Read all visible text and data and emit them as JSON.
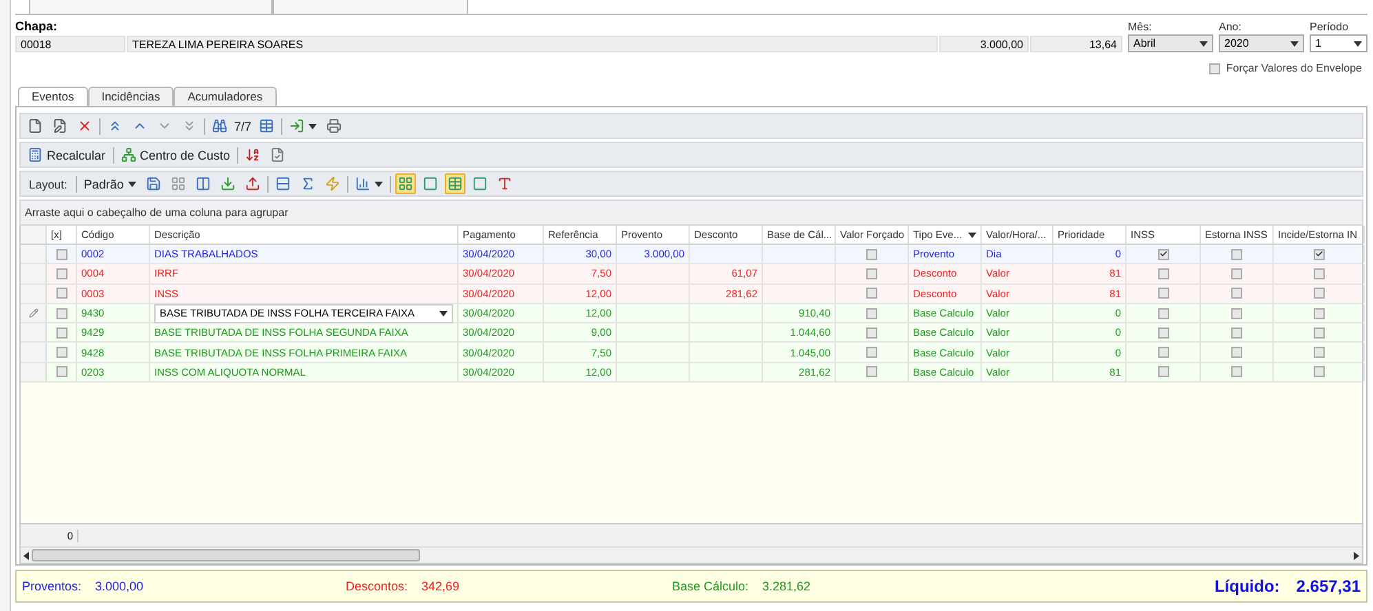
{
  "form": {
    "label": "Chapa:",
    "code": "00018",
    "name": "TEREZA LIMA PEREIRA SOARES",
    "value_1": "3.000,00",
    "value_2": "13,64"
  },
  "period": [
    {
      "label": "Mês:",
      "value": "Abril"
    },
    {
      "label": "Ano:",
      "value": "2020"
    },
    {
      "label": "Período",
      "value": "1"
    }
  ],
  "force_values": {
    "label": "Forçar Valores do Envelope",
    "checked": false
  },
  "tabs": [
    {
      "label": "Eventos",
      "selected": true
    },
    {
      "label": "Incidências",
      "selected": false
    },
    {
      "label": "Acumuladores",
      "selected": false
    }
  ],
  "toolbar": {
    "record_counter": "7/7"
  },
  "actions": [
    {
      "kind": "calc",
      "label": "Recalcular"
    },
    {
      "kind": "cost",
      "label": "Centro de Custo"
    }
  ],
  "layout_bar": {
    "label": "Layout:",
    "preset": "Padrão",
    "toggles": [
      {
        "selected": true
      },
      {
        "selected": false
      },
      {
        "selected": true
      },
      {
        "selected": false
      },
      {
        "selected": false
      }
    ]
  },
  "group_hint": "Arraste aqui o cabeçalho de uma coluna para agrupar",
  "table": {
    "columns": [
      {
        "label": "[x]",
        "kind": "check"
      },
      {
        "label": "Código",
        "kind": "text"
      },
      {
        "label": "Descrição",
        "kind": "text"
      },
      {
        "label": "Pagamento",
        "kind": "text"
      },
      {
        "label": "Referência",
        "kind": "number"
      },
      {
        "label": "Provento",
        "kind": "number"
      },
      {
        "label": "Desconto",
        "kind": "number"
      },
      {
        "label": "Base de Cál...",
        "kind": "number"
      },
      {
        "label": "Valor Forçado",
        "kind": "check"
      },
      {
        "label": "Tipo Eve...",
        "kind": "choice"
      },
      {
        "label": "Valor/Hora/...",
        "kind": "text"
      },
      {
        "label": "Prioridade",
        "kind": "number"
      },
      {
        "label": "INSS",
        "kind": "check"
      },
      {
        "label": "Estorna INSS",
        "kind": "check"
      },
      {
        "label": "Incide/Estorna IN",
        "kind": "check"
      }
    ],
    "rows": [
      {
        "kind": "provento",
        "editing": false,
        "cells": [
          false,
          "0002",
          "DIAS TRABALHADOS",
          "30/04/2020",
          "30,00",
          "3.000,00",
          null,
          null,
          false,
          "Provento",
          "Dia",
          "0",
          true,
          false,
          true
        ]
      },
      {
        "kind": "desconto",
        "editing": false,
        "cells": [
          false,
          "0004",
          "IRRF",
          "30/04/2020",
          "7,50",
          null,
          "61,07",
          null,
          false,
          "Desconto",
          "Valor",
          "81",
          false,
          false,
          false
        ]
      },
      {
        "kind": "desconto",
        "editing": false,
        "cells": [
          false,
          "0003",
          "INSS",
          "30/04/2020",
          "12,00",
          null,
          "281,62",
          null,
          false,
          "Desconto",
          "Valor",
          "81",
          false,
          false,
          false
        ]
      },
      {
        "kind": "base",
        "editing": true,
        "cells": [
          false,
          "9430",
          "BASE TRIBUTADA DE INSS FOLHA TERCEIRA FAIXA",
          "30/04/2020",
          "12,00",
          null,
          null,
          "910,40",
          false,
          "Base Calculo",
          "Valor",
          "0",
          false,
          false,
          false
        ]
      },
      {
        "kind": "base",
        "editing": false,
        "cells": [
          false,
          "9429",
          "BASE TRIBUTADA DE INSS FOLHA SEGUNDA FAIXA",
          "30/04/2020",
          "9,00",
          null,
          null,
          "1.044,60",
          false,
          "Base Calculo",
          "Valor",
          "0",
          false,
          false,
          false
        ]
      },
      {
        "kind": "base",
        "editing": false,
        "cells": [
          false,
          "9428",
          "BASE TRIBUTADA DE INSS FOLHA PRIMEIRA FAIXA",
          "30/04/2020",
          "7,50",
          null,
          null,
          "1.045,00",
          false,
          "Base Calculo",
          "Valor",
          "0",
          false,
          false,
          false
        ]
      },
      {
        "kind": "base",
        "editing": false,
        "cells": [
          false,
          "0203",
          "INSS COM ALIQUOTA NORMAL",
          "30/04/2020",
          "12,00",
          null,
          null,
          "281,62",
          false,
          "Base Calculo",
          "Valor",
          "81",
          false,
          false,
          false
        ]
      }
    ],
    "footer_count": "0"
  },
  "totals": [
    {
      "kind": "provento",
      "label": "Proventos:",
      "value": "3.000,00"
    },
    {
      "kind": "desconto",
      "label": "Descontos:",
      "value": "342,69"
    },
    {
      "kind": "base",
      "label": "Base Cálculo:",
      "value": "3.281,62"
    }
  ],
  "net": {
    "label": "Líquido:",
    "value": "2.657,31"
  }
}
